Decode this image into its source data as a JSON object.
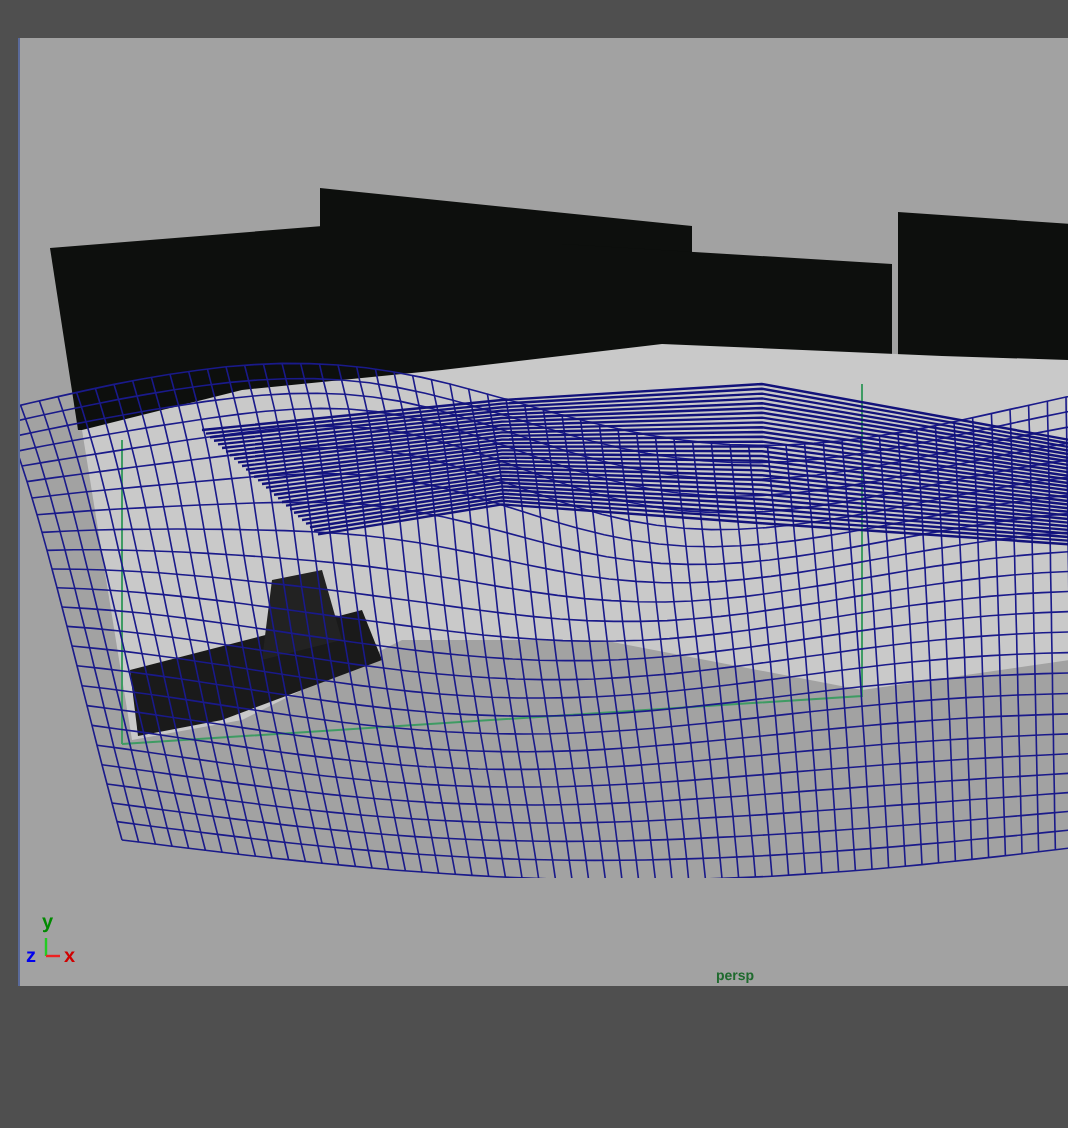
{
  "viewport": {
    "camera_label": "persp",
    "axes": [
      {
        "label": "y",
        "color": "#008a00"
      },
      {
        "label": "z",
        "color": "#0000ee"
      },
      {
        "label": "x",
        "color": "#d00000"
      }
    ]
  }
}
